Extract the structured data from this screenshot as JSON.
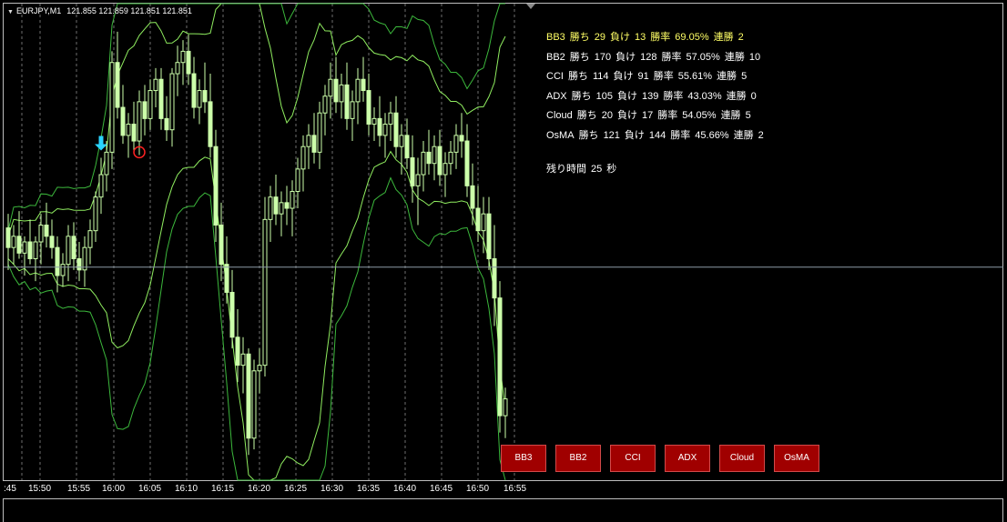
{
  "header": {
    "symbol": "EURJPY,M1",
    "ohlc": "121.855 121.859 121.851 121.851"
  },
  "stats": [
    {
      "name": "BB3",
      "win_label": "勝ち",
      "wins": "29",
      "loss_label": "負け",
      "losses": "13",
      "rate_label": "勝率",
      "rate": "69.05%",
      "streak_label": "連勝",
      "streak": "2",
      "highlight": true
    },
    {
      "name": "BB2",
      "win_label": "勝ち",
      "wins": "170",
      "loss_label": "負け",
      "losses": "128",
      "rate_label": "勝率",
      "rate": "57.05%",
      "streak_label": "連勝",
      "streak": "10",
      "highlight": false
    },
    {
      "name": "CCI",
      "win_label": "勝ち",
      "wins": "114",
      "loss_label": "負け",
      "losses": "91",
      "rate_label": "勝率",
      "rate": "55.61%",
      "streak_label": "連勝",
      "streak": "5",
      "highlight": false
    },
    {
      "name": "ADX",
      "win_label": "勝ち",
      "wins": "105",
      "loss_label": "負け",
      "losses": "139",
      "rate_label": "勝率",
      "rate": "43.03%",
      "streak_label": "連勝",
      "streak": "0",
      "highlight": false
    },
    {
      "name": "Cloud",
      "win_label": "勝ち",
      "wins": "20",
      "loss_label": "負け",
      "losses": "17",
      "rate_label": "勝率",
      "rate": "54.05%",
      "streak_label": "連勝",
      "streak": "5",
      "highlight": false
    },
    {
      "name": "OsMA",
      "win_label": "勝ち",
      "wins": "121",
      "loss_label": "負け",
      "losses": "144",
      "rate_label": "勝率",
      "rate": "45.66%",
      "streak_label": "連勝",
      "streak": "2",
      "highlight": false
    }
  ],
  "remaining": {
    "label": "残り時間",
    "value": "25",
    "unit": "秒"
  },
  "buttons": [
    {
      "label": "BB3"
    },
    {
      "label": "BB2"
    },
    {
      "label": "CCI"
    },
    {
      "label": "ADX"
    },
    {
      "label": "Cloud"
    },
    {
      "label": "OsMA"
    }
  ],
  "colors": {
    "candle": "#ccffaa",
    "band": "#90ee60",
    "outer_band": "#3cb83c",
    "grid": "#c8c8c8",
    "bid_line": "#8c9aa5",
    "arrow": "#2ad4ff",
    "circle": "#ff2222",
    "button": "#a00000"
  },
  "chart_data": {
    "type": "candlestick",
    "timeframe": "M1",
    "price_range": [
      121.775,
      121.945
    ],
    "time_labels": [
      ":45",
      "15:50",
      "15:55",
      "16:00",
      "16:05",
      "16:10",
      "16:15",
      "16:20",
      "16:25",
      "16:30",
      "16:35",
      "16:40",
      "16:45",
      "16:50",
      "16:55"
    ],
    "candles": [
      [
        121.865,
        121.87,
        121.85,
        121.858
      ],
      [
        121.858,
        121.866,
        121.852,
        121.862
      ],
      [
        121.862,
        121.871,
        121.854,
        121.856
      ],
      [
        121.856,
        121.862,
        121.848,
        121.86
      ],
      [
        121.86,
        121.868,
        121.852,
        121.854
      ],
      [
        121.854,
        121.862,
        121.846,
        121.86
      ],
      [
        121.86,
        121.87,
        121.852,
        121.866
      ],
      [
        121.866,
        121.874,
        121.858,
        121.862
      ],
      [
        121.862,
        121.868,
        121.854,
        121.858
      ],
      [
        121.858,
        121.862,
        121.842,
        121.848
      ],
      [
        121.848,
        121.856,
        121.844,
        121.852
      ],
      [
        121.852,
        121.866,
        121.846,
        121.862
      ],
      [
        121.862,
        121.867,
        121.85,
        121.854
      ],
      [
        121.854,
        121.86,
        121.846,
        121.85
      ],
      [
        121.85,
        121.862,
        121.844,
        121.858
      ],
      [
        121.858,
        121.868,
        121.852,
        121.864
      ],
      [
        121.864,
        121.878,
        121.86,
        121.876
      ],
      [
        121.876,
        121.89,
        121.87,
        121.884
      ],
      [
        121.884,
        121.896,
        121.878,
        121.892
      ],
      [
        121.892,
        121.928,
        121.886,
        121.924
      ],
      [
        121.924,
        121.935,
        121.904,
        121.908
      ],
      [
        121.908,
        121.916,
        121.895,
        121.898
      ],
      [
        121.898,
        121.906,
        121.89,
        121.902
      ],
      [
        121.902,
        121.91,
        121.892,
        121.896
      ],
      [
        121.896,
        121.914,
        121.891,
        121.91
      ],
      [
        121.91,
        121.916,
        121.898,
        121.904
      ],
      [
        121.904,
        121.918,
        121.9,
        121.914
      ],
      [
        121.914,
        121.922,
        121.908,
        121.918
      ],
      [
        121.918,
        121.922,
        121.9,
        121.904
      ],
      [
        121.904,
        121.912,
        121.896,
        121.9
      ],
      [
        121.9,
        121.922,
        121.894,
        121.92
      ],
      [
        121.92,
        121.93,
        121.912,
        121.924
      ],
      [
        121.924,
        121.932,
        121.916,
        121.928
      ],
      [
        121.928,
        121.934,
        121.916,
        121.92
      ],
      [
        121.92,
        121.926,
        121.904,
        121.908
      ],
      [
        121.908,
        121.918,
        121.902,
        121.914
      ],
      [
        121.914,
        121.924,
        121.906,
        121.91
      ],
      [
        121.91,
        121.92,
        121.89,
        121.894
      ],
      [
        121.894,
        121.9,
        121.86,
        121.866
      ],
      [
        121.866,
        121.874,
        121.846,
        121.852
      ],
      [
        121.852,
        121.862,
        121.838,
        121.842
      ],
      [
        121.842,
        121.85,
        121.822,
        121.826
      ],
      [
        121.826,
        121.836,
        121.81,
        121.816
      ],
      [
        121.816,
        121.826,
        121.806,
        121.82
      ],
      [
        121.82,
        121.822,
        121.784,
        121.79
      ],
      [
        121.79,
        121.818,
        121.786,
        121.814
      ],
      [
        121.814,
        121.822,
        121.806,
        121.816
      ],
      [
        121.816,
        121.876,
        121.812,
        121.868
      ],
      [
        121.868,
        121.88,
        121.86,
        121.876
      ],
      [
        121.876,
        121.884,
        121.866,
        121.87
      ],
      [
        121.87,
        121.878,
        121.862,
        121.874
      ],
      [
        121.874,
        121.88,
        121.866,
        121.872
      ],
      [
        121.872,
        121.882,
        121.862,
        121.878
      ],
      [
        121.878,
        121.89,
        121.872,
        121.886
      ],
      [
        121.886,
        121.898,
        121.878,
        121.894
      ],
      [
        121.894,
        121.902,
        121.886,
        121.898
      ],
      [
        121.898,
        121.906,
        121.888,
        121.892
      ],
      [
        121.892,
        121.91,
        121.886,
        121.906
      ],
      [
        121.906,
        121.916,
        121.898,
        121.912
      ],
      [
        121.912,
        121.924,
        121.904,
        121.918
      ],
      [
        121.918,
        121.926,
        121.906,
        121.91
      ],
      [
        121.91,
        121.92,
        121.904,
        121.916
      ],
      [
        121.916,
        121.924,
        121.9,
        121.904
      ],
      [
        121.904,
        121.914,
        121.896,
        121.91
      ],
      [
        121.91,
        121.922,
        121.902,
        121.918
      ],
      [
        121.918,
        121.926,
        121.91,
        121.914
      ],
      [
        121.914,
        121.92,
        121.898,
        121.902
      ],
      [
        121.902,
        121.908,
        121.896,
        121.904
      ],
      [
        121.904,
        121.912,
        121.894,
        121.898
      ],
      [
        121.898,
        121.906,
        121.89,
        121.902
      ],
      [
        121.902,
        121.91,
        121.896,
        121.906
      ],
      [
        121.906,
        121.912,
        121.89,
        121.894
      ],
      [
        121.894,
        121.902,
        121.884,
        121.898
      ],
      [
        121.898,
        121.904,
        121.886,
        121.89
      ],
      [
        121.89,
        121.898,
        121.874,
        121.88
      ],
      [
        121.88,
        121.89,
        121.866,
        121.884
      ],
      [
        121.884,
        121.896,
        121.878,
        121.892
      ],
      [
        121.892,
        121.9,
        121.884,
        121.888
      ],
      [
        121.888,
        121.898,
        121.882,
        121.894
      ],
      [
        121.894,
        121.9,
        121.88,
        121.884
      ],
      [
        121.884,
        121.892,
        121.876,
        121.888
      ],
      [
        121.888,
        121.896,
        121.884,
        121.892
      ],
      [
        121.892,
        121.902,
        121.886,
        121.898
      ],
      [
        121.898,
        121.906,
        121.89,
        121.896
      ],
      [
        121.896,
        121.902,
        121.876,
        121.88
      ],
      [
        121.88,
        121.888,
        121.866,
        121.872
      ],
      [
        121.872,
        121.88,
        121.86,
        121.864
      ],
      [
        121.864,
        121.876,
        121.856,
        121.87
      ],
      [
        121.87,
        121.876,
        121.85,
        121.854
      ],
      [
        121.854,
        121.866,
        121.83,
        121.84
      ],
      [
        121.84,
        121.846,
        121.792,
        121.798
      ],
      [
        121.798,
        121.808,
        121.79,
        121.804
      ]
    ],
    "markers": [
      {
        "type": "down-arrow",
        "candle_index": 17
      },
      {
        "type": "circle",
        "price": 121.892,
        "candle_index": 24
      }
    ],
    "bid_price": 121.851
  }
}
